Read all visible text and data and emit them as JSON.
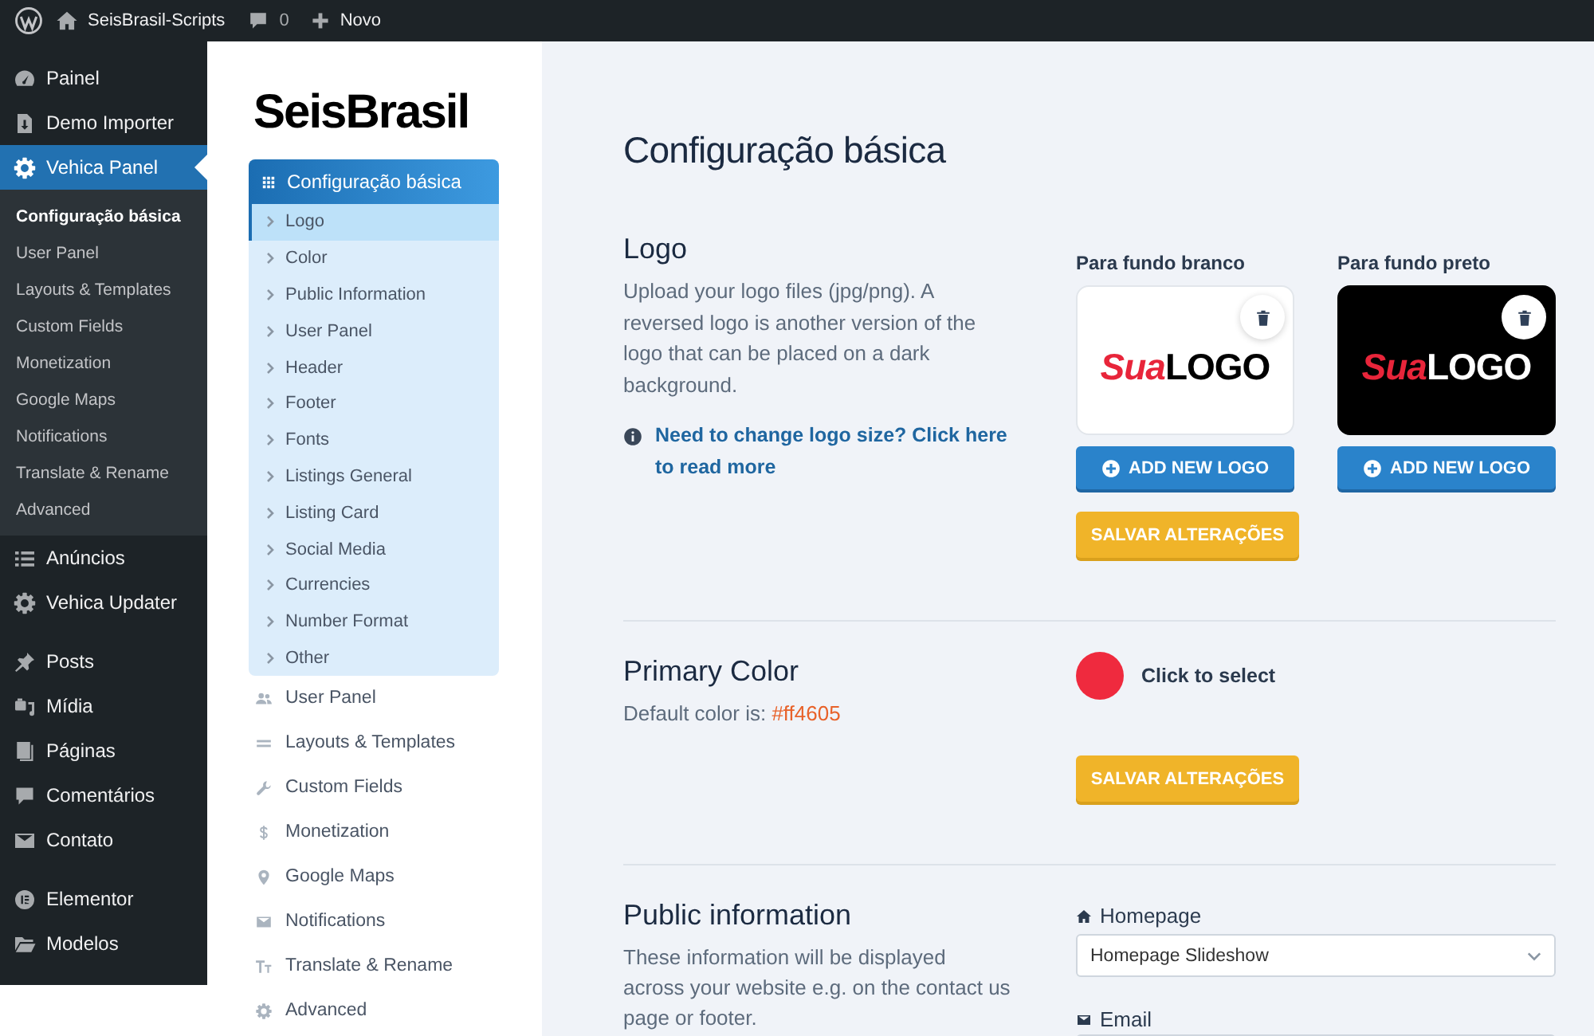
{
  "admin_bar": {
    "site_name": "SeisBrasil-Scripts",
    "comments": "0",
    "new_label": "Novo"
  },
  "sidebar": {
    "groups": [
      {
        "items": [
          {
            "label": "Painel",
            "selected": false
          },
          {
            "label": "Demo Importer",
            "selected": false
          },
          {
            "label": "Vehica Panel",
            "selected": true,
            "children": [
              {
                "label": "Configuração básica",
                "selected": true
              },
              {
                "label": "User Panel",
                "selected": false
              },
              {
                "label": "Layouts & Templates",
                "selected": false
              },
              {
                "label": "Custom Fields",
                "selected": false
              },
              {
                "label": "Monetization",
                "selected": false
              },
              {
                "label": "Google Maps",
                "selected": false
              },
              {
                "label": "Notifications",
                "selected": false
              },
              {
                "label": "Translate & Rename",
                "selected": false
              },
              {
                "label": "Advanced",
                "selected": false
              }
            ]
          },
          {
            "label": "Anúncios",
            "selected": false
          },
          {
            "label": "Vehica Updater",
            "selected": false
          }
        ]
      },
      {
        "items": [
          {
            "label": "Posts",
            "selected": false
          },
          {
            "label": "Mídia",
            "selected": false
          },
          {
            "label": "Páginas",
            "selected": false
          },
          {
            "label": "Comentários",
            "selected": false
          },
          {
            "label": "Contato",
            "selected": false
          }
        ]
      },
      {
        "items": [
          {
            "label": "Elementor",
            "selected": false
          },
          {
            "label": "Modelos",
            "selected": false
          }
        ]
      }
    ]
  },
  "panel_menu": {
    "brand": "SeisBrasil",
    "sections": [
      {
        "label": "Configuração básica",
        "selected": true,
        "children": [
          {
            "label": "Logo",
            "selected": true
          },
          {
            "label": "Color",
            "selected": false
          },
          {
            "label": "Public Information",
            "selected": false
          },
          {
            "label": "User Panel",
            "selected": false
          },
          {
            "label": "Header",
            "selected": false
          },
          {
            "label": "Footer",
            "selected": false
          },
          {
            "label": "Fonts",
            "selected": false
          },
          {
            "label": "Listings General",
            "selected": false
          },
          {
            "label": "Listing Card",
            "selected": false
          },
          {
            "label": "Social Media",
            "selected": false
          },
          {
            "label": "Currencies",
            "selected": false
          },
          {
            "label": "Number Format",
            "selected": false
          },
          {
            "label": "Other",
            "selected": false
          }
        ]
      },
      {
        "label": "User Panel",
        "selected": false
      },
      {
        "label": "Layouts & Templates",
        "selected": false
      },
      {
        "label": "Custom Fields",
        "selected": false
      },
      {
        "label": "Monetization",
        "selected": false
      },
      {
        "label": "Google Maps",
        "selected": false
      },
      {
        "label": "Notifications",
        "selected": false
      },
      {
        "label": "Translate & Rename",
        "selected": false
      },
      {
        "label": "Advanced",
        "selected": false
      }
    ]
  },
  "content": {
    "title": "Configuração básica",
    "sections": [
      {
        "kind": "logo",
        "title": "Logo",
        "description": "Upload your logo files (jpg/png). A reversed logo is another version of the logo that can be placed on a dark background.",
        "help_link": "Need to change logo size? Click here to read more",
        "logos": [
          {
            "label": "Para fundo branco",
            "dark": false,
            "preview": {
              "accent": "Sua",
              "rest": "LOGO"
            },
            "button": "ADD NEW LOGO"
          },
          {
            "label": "Para fundo preto",
            "dark": true,
            "preview": {
              "accent": "Sua",
              "rest": "LOGO"
            },
            "button": "ADD NEW LOGO"
          }
        ],
        "save_button": "SALVAR ALTERAÇÕES"
      },
      {
        "kind": "color",
        "title": "Primary Color",
        "description": "Default color is:",
        "default_value": "#ff4605",
        "color": "#ef2a3e",
        "picker_label": "Click to select",
        "save_button": "SALVAR ALTERAÇÕES"
      },
      {
        "kind": "info",
        "title": "Public information",
        "description": "These information will be displayed across your website e.g. on the contact us page or footer.",
        "fields": [
          {
            "kind": "select",
            "label": "Homepage",
            "value": "Homepage Slideshow"
          },
          {
            "kind": "input",
            "label": "Email"
          }
        ]
      }
    ]
  }
}
